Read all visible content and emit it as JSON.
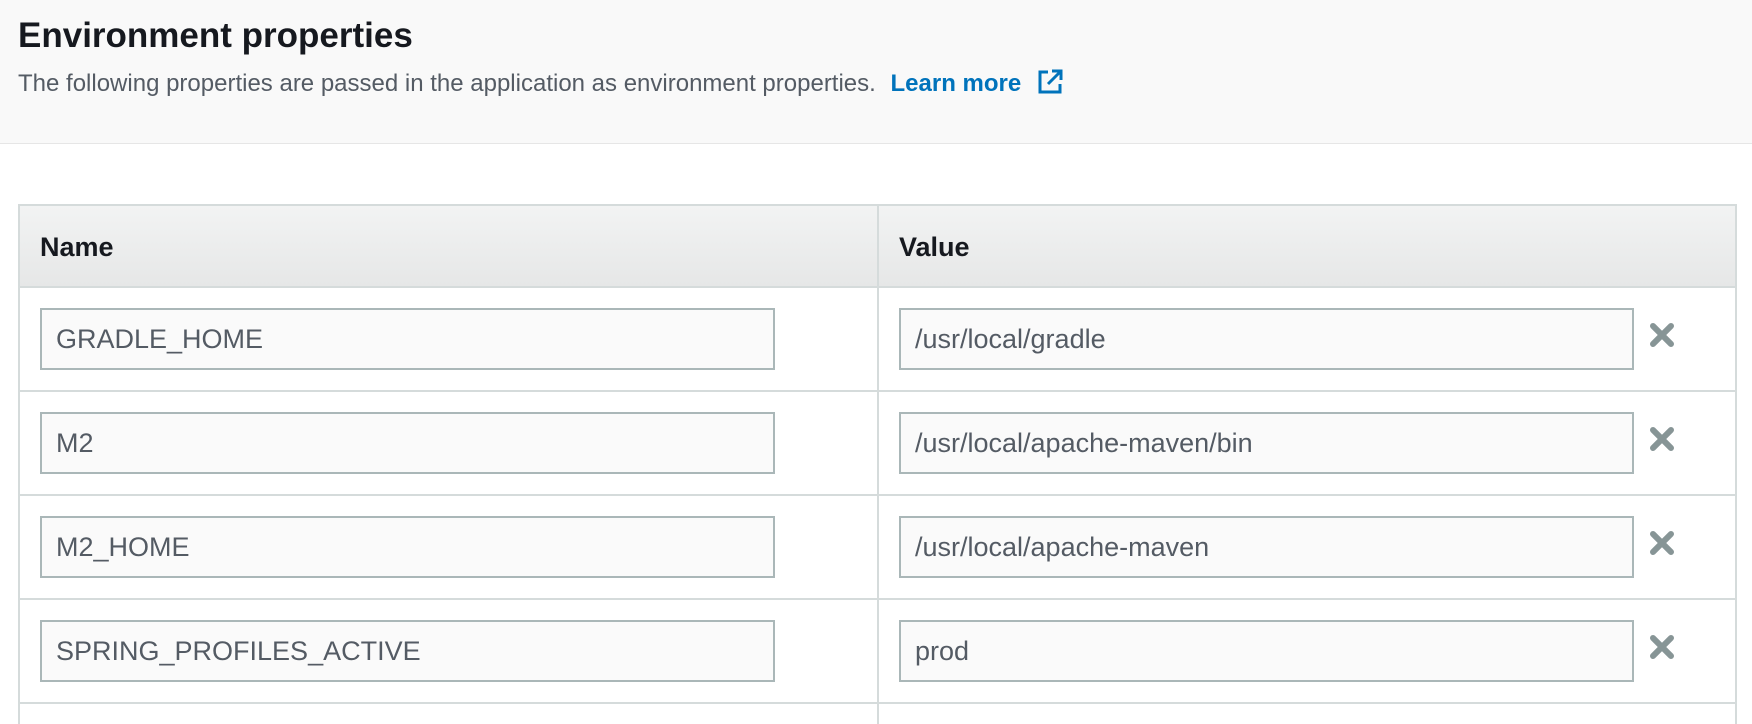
{
  "header": {
    "title": "Environment properties",
    "description": "The following properties are passed in the application as environment properties.",
    "learn_more_label": "Learn more",
    "learn_more_icon": "external-link-icon"
  },
  "table": {
    "columns": {
      "name": "Name",
      "value": "Value"
    },
    "rows": [
      {
        "name": "GRADLE_HOME",
        "value": "/usr/local/gradle"
      },
      {
        "name": "M2",
        "value": "/usr/local/apache-maven/bin"
      },
      {
        "name": "M2_HOME",
        "value": "/usr/local/apache-maven"
      },
      {
        "name": "SPRING_PROFILES_ACTIVE",
        "value": "prod"
      }
    ],
    "remove_icon": "close-icon"
  },
  "colors": {
    "link": "#0073bb",
    "header_bg": "#f9f9f9",
    "border": "#d5dbdb",
    "icon_gray": "#879596"
  }
}
